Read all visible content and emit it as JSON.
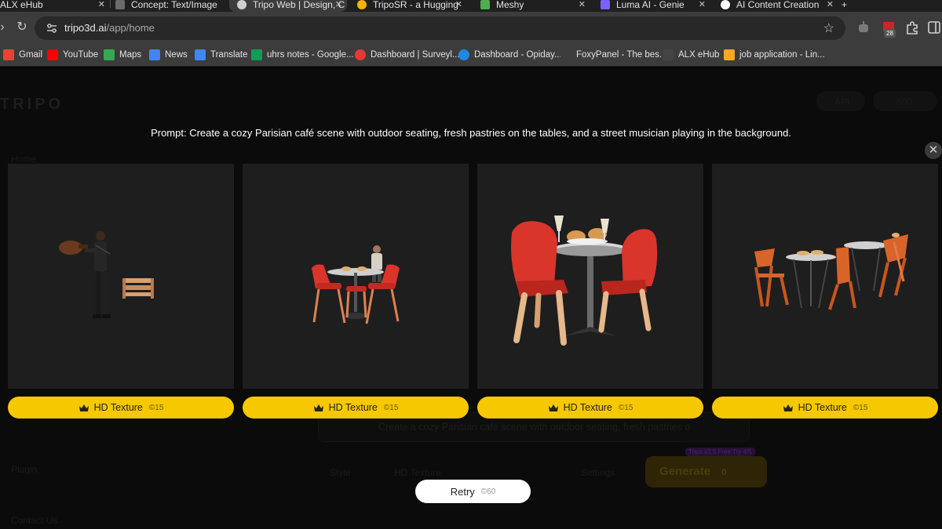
{
  "browser": {
    "tabs": [
      {
        "title": "ALX eHub",
        "color": "#5b5b5b",
        "active": false
      },
      {
        "title": "Concept: Text/Image",
        "color": "#6b6b6b",
        "active": false
      },
      {
        "title": "Tripo Web | Design, C",
        "color": "#d0d0d0",
        "active": true
      },
      {
        "title": "TripoSR - a Hugging",
        "color": "#f5b400",
        "active": false
      },
      {
        "title": "Meshy",
        "color": "#4caf50",
        "active": false
      },
      {
        "title": "Luma AI - Genie",
        "color": "#7b61ff",
        "active": false
      },
      {
        "title": "AI Content Creation",
        "color": "#ffffff",
        "active": false
      }
    ],
    "url_host": "tripo3d.ai",
    "url_path": "/app/home",
    "extension_badge": "28",
    "bookmarks": [
      {
        "label": "Gmail",
        "color": "#ea4335"
      },
      {
        "label": "YouTube",
        "color": "#ff0000"
      },
      {
        "label": "Maps",
        "color": "#34a853"
      },
      {
        "label": "News",
        "color": "#4285f4"
      },
      {
        "label": "Translate",
        "color": "#4285f4"
      },
      {
        "label": "uhrs notes - Google...",
        "color": "#0f9d58"
      },
      {
        "label": "Dashboard | Surveyl...",
        "color": "#e53935"
      },
      {
        "label": "Dashboard - Opiday...",
        "color": "#1e88e5"
      },
      {
        "label": "FoxyPanel - The bes...",
        "color": "#3c3c3c"
      },
      {
        "label": "ALX eHub",
        "color": "#444444"
      },
      {
        "label": "job application - Lin...",
        "color": "#f9a825"
      }
    ]
  },
  "app": {
    "logo": "TRIPO",
    "background": {
      "nav_home": "Home",
      "nav_plugin": "Plugin",
      "nav_contact": "Contact Us",
      "api_label": "API",
      "credits": "600",
      "prompt_placeholder": "Create a cozy Parisian café scene with outdoor seating, fresh pastries o",
      "style_label": "Style",
      "hd_texture_label": "HD Texture",
      "settings_label": "Settings",
      "generate_label": "Generate",
      "generate_cost": "0",
      "free_badge": "Tripo v2.5 Free Try 4/5"
    },
    "modal": {
      "prompt_text": "Prompt: Create a cozy Parisian café scene with outdoor seating, fresh pastries on the tables, and a street musician playing in the background.",
      "close_symbol": "✕",
      "results": [
        {
          "button_label": "HD Texture",
          "cost": "©15",
          "subject": "street-musician-with-bench"
        },
        {
          "button_label": "HD Texture",
          "cost": "©15",
          "subject": "table-with-red-chairs-and-musician"
        },
        {
          "button_label": "HD Texture",
          "cost": "©15",
          "subject": "bistro-table-red-chairs-pastries"
        },
        {
          "button_label": "HD Texture",
          "cost": "©15",
          "subject": "two-tables-orange-folding-chairs"
        }
      ],
      "retry_label": "Retry",
      "retry_cost": "©60"
    }
  },
  "colors": {
    "accent_yellow": "#f5c800",
    "card_bg": "#1e1e1e",
    "chair_red": "#d9352b",
    "chair_orange": "#d8642a"
  }
}
